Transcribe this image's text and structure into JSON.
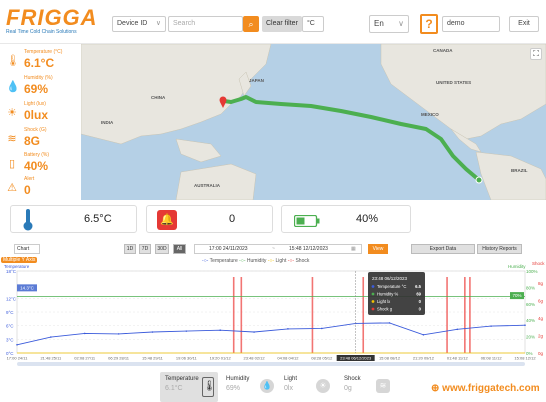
{
  "header": {
    "brand": "FRIGGA",
    "tagline": "Real Time Cold Chain Solutions",
    "device_select": "Device ID",
    "search_placeholder": "Search",
    "clear_filter": "Clear filter",
    "unit_select": "°C",
    "language": "En",
    "user": "demo",
    "exit": "Exit"
  },
  "metrics": [
    {
      "label": "Temperature (°C)",
      "value": "6.1°C",
      "icon": "thermometer-icon"
    },
    {
      "label": "Humidity (%)",
      "value": "69%",
      "icon": "humidity-icon"
    },
    {
      "label": "Light (lux)",
      "value": "0lux",
      "icon": "sun-icon"
    },
    {
      "label": "Shock (G)",
      "value": "8G",
      "icon": "shock-icon"
    },
    {
      "label": "Battery (%)",
      "value": "40%",
      "icon": "battery-icon"
    },
    {
      "label": "Alert",
      "value": "0",
      "icon": "alert-icon"
    }
  ],
  "map": {
    "labels": [
      "CANADA",
      "UNITED STATES",
      "CHINA",
      "AUSTRALIA",
      "BRAZIL",
      "MEXICO",
      "INDIA",
      "JAPAN"
    ],
    "route_color": "#4caf50"
  },
  "summary": {
    "temperature": "6.5°C",
    "alerts": "0",
    "battery": "40%"
  },
  "controls": {
    "chart_select": "Chart",
    "ranges": [
      "1D",
      "7D",
      "30D",
      "All"
    ],
    "start": "17:00 24/11/2023",
    "tilde": "~",
    "end": "15:48 12/12/2023",
    "view": "View",
    "export": "Export Data",
    "history": "History Reports",
    "multiple_y": "Multiple Y Axis",
    "legend": [
      "Temperature",
      "Humidity",
      "Light",
      "Shock"
    ]
  },
  "chart_data": {
    "type": "line",
    "title": "",
    "x": [
      "17:00 24/11",
      "21:48 25/11",
      "02:08 27/11",
      "06:29 28/11",
      "15:48 29/11",
      "19:06 30/11",
      "19:20 01/12",
      "23:48 02/12",
      "04:08 04/12",
      "08:28 05/12",
      "23:48 06/12/2023",
      "15:08 08/12",
      "21:20 09/12",
      "01:48 11/12",
      "06:08 11/12",
      "15:08 12/12"
    ],
    "temperature_ticks": [
      "18°C",
      "12°C",
      "9°C",
      "6°C",
      "3°C",
      "0°C"
    ],
    "humidity_ticks": [
      "100%",
      "80%",
      "60%",
      "40%",
      "20%",
      "0%"
    ],
    "shock_ticks": [
      "8g",
      "6g",
      "4g",
      "2g",
      "0g"
    ],
    "series": [
      {
        "name": "Temperature",
        "color": "#3b5bdb",
        "values": [
          1.8,
          3.5,
          4.3,
          4.2,
          4.6,
          4.8,
          5.0,
          4.6,
          5.3,
          5.4,
          6.5,
          6.6,
          4.0,
          5.2,
          5.9,
          6.1
        ]
      },
      {
        "name": "Humidity",
        "color": "#4caf50",
        "values": [
          69,
          69,
          69,
          69,
          69,
          69,
          69,
          69,
          69,
          69,
          69,
          69,
          69,
          69,
          69,
          69
        ]
      },
      {
        "name": "Light",
        "color": "#f2c300",
        "values": [
          0,
          0,
          0,
          0,
          0,
          0,
          0,
          0,
          0,
          0,
          0,
          0,
          0,
          0,
          0,
          0
        ]
      },
      {
        "name": "Shock",
        "color": "#e53935",
        "values": [
          0,
          0,
          0,
          0,
          0,
          0,
          0,
          8,
          0,
          0,
          0,
          0,
          0,
          8,
          0,
          0
        ]
      }
    ],
    "ylim": [
      0,
      18
    ],
    "left_badges": [
      "14.3°C"
    ],
    "right_badges": [
      "70%"
    ],
    "tooltip": {
      "title": "23:48 06/12/2023",
      "rows": [
        {
          "label": "Temperature °C",
          "value": "6.5"
        },
        {
          "label": "Humidity %",
          "value": "69"
        },
        {
          "label": "Light lx",
          "value": "0"
        },
        {
          "label": "Shock g",
          "value": "0"
        }
      ]
    }
  },
  "bottom": {
    "tabs": [
      {
        "label": "Temperature",
        "value": "6.1°C",
        "icon": "thermometer-icon"
      },
      {
        "label": "Humidity",
        "value": "69%",
        "icon": "humidity-icon"
      },
      {
        "label": "Light",
        "value": "0lx",
        "icon": "sun-icon"
      },
      {
        "label": "Shock",
        "value": "0g",
        "icon": "shock-icon"
      }
    ],
    "website": "www.friggatech.com"
  }
}
